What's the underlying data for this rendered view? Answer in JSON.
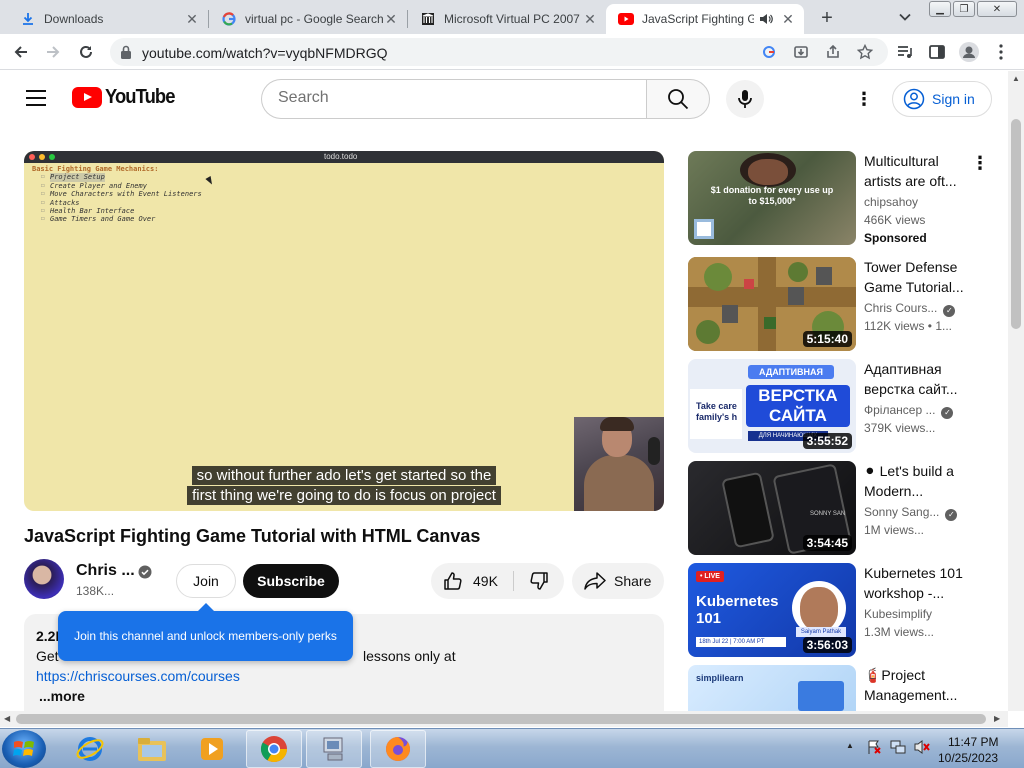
{
  "browser": {
    "tabs": [
      {
        "title": "Downloads",
        "icon": "download-icon"
      },
      {
        "title": "virtual pc - Google Search",
        "icon": "google-icon"
      },
      {
        "title": "Microsoft Virtual PC 2007",
        "icon": "building-icon"
      },
      {
        "title": "JavaScript Fighting G",
        "icon": "youtube-icon",
        "active": true
      }
    ],
    "url": "youtube.com/watch?v=vyqbNFMDRGQ"
  },
  "youtube": {
    "logo_text": "YouTube",
    "search_placeholder": "Search",
    "sign_in": "Sign in",
    "video": {
      "todo_file": "todo.todo",
      "todo_heading": "Basic Fighting Game Mechanics:",
      "todo_items": [
        "Project Setup",
        "Create Player and Enemy",
        "Move Characters with Event Listeners",
        "Attacks",
        "Health Bar Interface",
        "Game Timers and Game Over"
      ],
      "caption_line1": "so without further ado let's get started so the",
      "caption_line2": "first thing we're going to do is focus on project"
    },
    "title": "JavaScript Fighting Game Tutorial with HTML Canvas",
    "channel": {
      "name": "Chris ...",
      "subscribers": "138K..."
    },
    "join": "Join",
    "subscribe": "Subscribe",
    "likes": "49K",
    "share": "Share",
    "description": {
      "views": "2.2K",
      "line_start": "Get",
      "line_end": "lessons only at",
      "link": "https://chriscourses.com/courses",
      "more": "...more"
    },
    "tooltip": "Join this channel and unlock members-only perks",
    "recommendations": [
      {
        "title": "Multicultural artists are oft...",
        "channel": "chipsahoy",
        "meta": "466K views",
        "sponsored": "Sponsored",
        "thumb_text": "$1 donation for every use up to $15,000*"
      },
      {
        "title": "Tower Defense Game Tutorial...",
        "channel": "Chris Cours...",
        "meta": "112K views • 1...",
        "duration": "5:15:40"
      },
      {
        "title": "Адаптивная верстка сайт...",
        "channel": "Фрілансер ...",
        "meta": "379K views...",
        "duration": "3:55:52",
        "thumb_text": "ВЕРСТКА САЙТА",
        "thumb_badge": "АДАПТИВНАЯ",
        "thumb_side": "Take care family's h",
        "thumb_bottom": "ДЛЯ НАЧИНАЮЩИХ"
      },
      {
        "title": "⚫ Let's build a Modern...",
        "channel": "Sonny Sang...",
        "meta": "1M views...",
        "duration": "3:54:45",
        "thumb_text": "SONNY SAN"
      },
      {
        "title": "Kubernetes 101 workshop -...",
        "channel": "Kubesimplify",
        "meta": "1.3M views...",
        "duration": "3:56:03",
        "thumb_text": "Kubernetes 101",
        "thumb_badge": "• LIVE",
        "thumb_side": "Saiyam Pathak",
        "thumb_bottom": "18th Jul 22 | 7:00 AM PT"
      },
      {
        "title": "🧯Project Management...",
        "channel": "",
        "meta": "",
        "thumb_text": "simplilearn"
      }
    ]
  },
  "taskbar": {
    "time": "11:47 PM",
    "date": "10/25/2023"
  },
  "colors": {
    "youtube_red": "#ff0000",
    "link_blue": "#065fd4",
    "tooltip_blue": "#1a73e8"
  }
}
